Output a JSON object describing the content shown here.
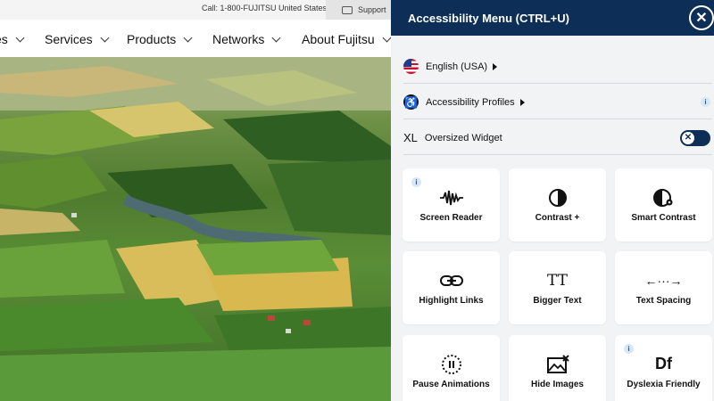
{
  "site": {
    "topbar": {
      "call_text": "Call: 1-800-FUJITSU United States",
      "support_label": "Support"
    },
    "nav": [
      "es",
      "Services",
      "Products",
      "Networks",
      "About Fujitsu"
    ]
  },
  "panel": {
    "title": "Accessibility Menu (CTRL+U)",
    "language_label": "English (USA)",
    "profiles_label": "Accessibility Profiles",
    "xl_prefix": "XL",
    "oversized_label": "Oversized Widget",
    "tiles": [
      {
        "label": "Screen Reader",
        "icon": "waveform-icon",
        "info": true
      },
      {
        "label": "Contrast +",
        "icon": "half-circle-icon"
      },
      {
        "label": "Smart Contrast",
        "icon": "half-circle-gear-icon"
      },
      {
        "label": "Highlight Links",
        "icon": "link-icon"
      },
      {
        "label": "Bigger Text",
        "icon": "text-size-icon",
        "glyph": "TT"
      },
      {
        "label": "Text Spacing",
        "icon": "spacing-arrows-icon",
        "glyph": "←···→"
      },
      {
        "label": "Pause Animations",
        "icon": "pause-spinner-icon"
      },
      {
        "label": "Hide Images",
        "icon": "hide-image-icon"
      },
      {
        "label": "Dyslexia Friendly",
        "icon": "df-font-icon",
        "glyph": "Df",
        "info": true
      }
    ]
  },
  "colors": {
    "header_bg": "#0c2e57",
    "panel_bg": "#f2f3f5",
    "info_dot": "#2c5d97"
  }
}
